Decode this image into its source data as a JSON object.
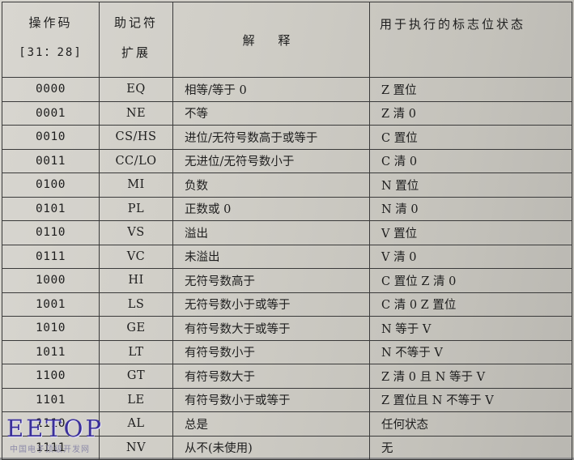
{
  "header": {
    "col1_line1": "操作码",
    "col1_line2": "[31：28]",
    "col2_line1": "助记符",
    "col2_line2": "扩展",
    "col3": "解 释",
    "col4": "用于执行的标志位状态"
  },
  "rows": [
    {
      "code": "0000",
      "mnemonic": "EQ",
      "meaning": "相等/等于 0",
      "flags": "Z 置位"
    },
    {
      "code": "0001",
      "mnemonic": "NE",
      "meaning": "不等",
      "flags": "Z 清 0"
    },
    {
      "code": "0010",
      "mnemonic": "CS/HS",
      "meaning": "进位/无符号数高于或等于",
      "flags": "C 置位"
    },
    {
      "code": "0011",
      "mnemonic": "CC/LO",
      "meaning": "无进位/无符号数小于",
      "flags": "C 清 0"
    },
    {
      "code": "0100",
      "mnemonic": "MI",
      "meaning": "负数",
      "flags": "N 置位"
    },
    {
      "code": "0101",
      "mnemonic": "PL",
      "meaning": "正数或 0",
      "flags": "N 清 0"
    },
    {
      "code": "0110",
      "mnemonic": "VS",
      "meaning": "溢出",
      "flags": "V 置位"
    },
    {
      "code": "0111",
      "mnemonic": "VC",
      "meaning": "未溢出",
      "flags": "V 清 0"
    },
    {
      "code": "1000",
      "mnemonic": "HI",
      "meaning": "无符号数高于",
      "flags": "C 置位 Z 清 0"
    },
    {
      "code": "1001",
      "mnemonic": "LS",
      "meaning": "无符号数小于或等于",
      "flags": "C 清 0 Z 置位"
    },
    {
      "code": "1010",
      "mnemonic": "GE",
      "meaning": "有符号数大于或等于",
      "flags": "N 等于 V"
    },
    {
      "code": "1011",
      "mnemonic": "LT",
      "meaning": "有符号数小于",
      "flags": "N 不等于 V"
    },
    {
      "code": "1100",
      "mnemonic": "GT",
      "meaning": "有符号数大于",
      "flags": "Z 清 0 且 N 等于 V"
    },
    {
      "code": "1101",
      "mnemonic": "LE",
      "meaning": "有符号数小于或等于",
      "flags": "Z 置位且 N 不等于 V"
    },
    {
      "code": "1110",
      "mnemonic": "AL",
      "meaning": "总是",
      "flags": "任何状态"
    },
    {
      "code": "1111",
      "mnemonic": "NV",
      "meaning": "从不(未使用)",
      "flags": "无"
    }
  ],
  "watermark": {
    "text": "EETOP",
    "subtext": "中国电子顶级开发网"
  }
}
